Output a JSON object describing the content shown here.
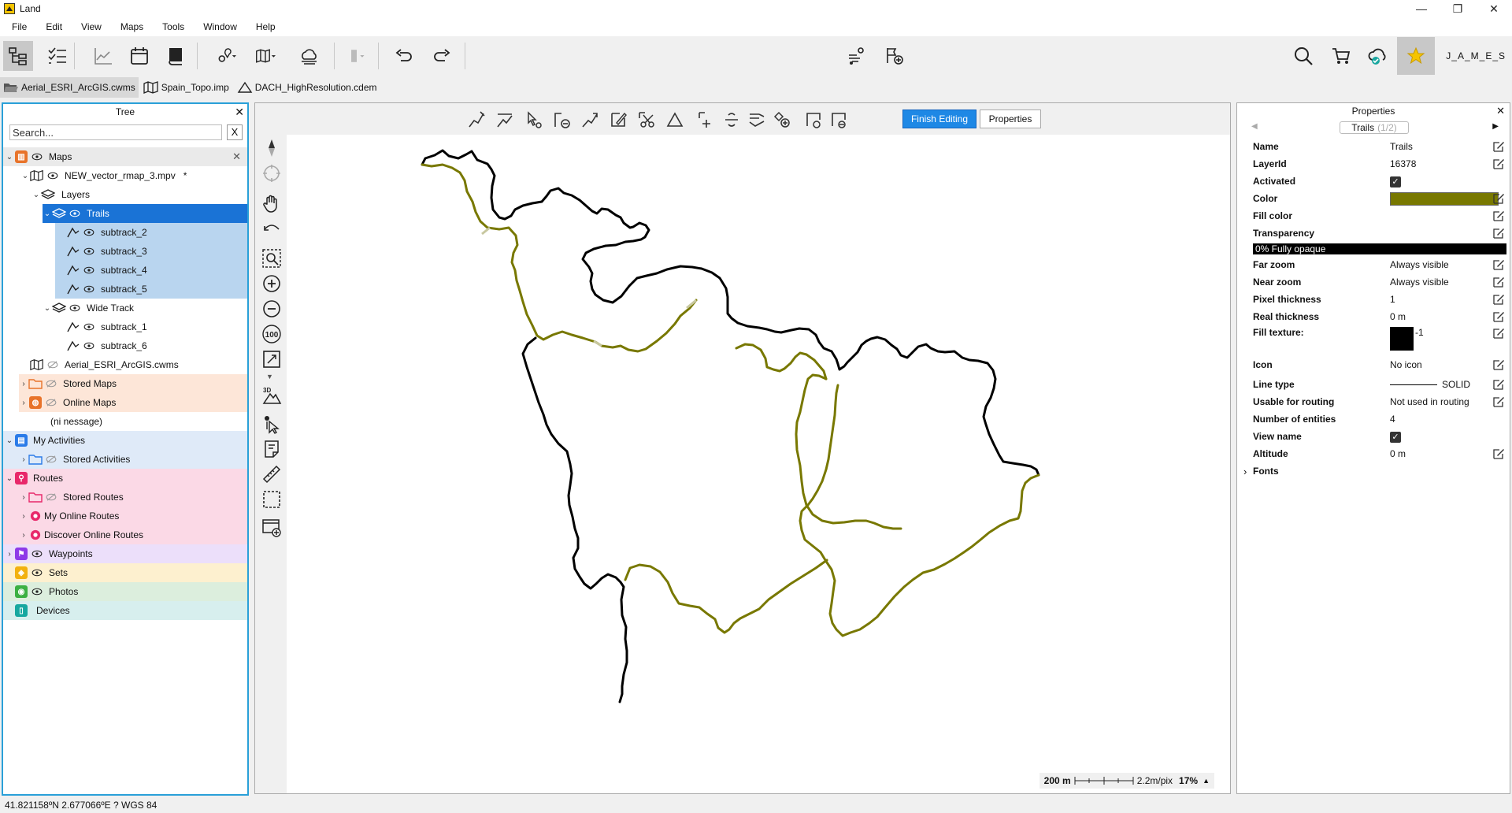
{
  "window": {
    "title": "Land",
    "minimize": "—",
    "maximize": "❐",
    "close": "✕"
  },
  "menu": [
    "File",
    "Edit",
    "View",
    "Maps",
    "Tools",
    "Window",
    "Help"
  ],
  "toolbar": {
    "user": "J_A_M_E_S"
  },
  "open_maps": [
    {
      "label": "Aerial_ESRI_ArcGIS.cwms",
      "icon": "folder-open-icon"
    },
    {
      "label": "Spain_Topo.imp",
      "icon": "map-icon"
    },
    {
      "label": "DACH_HighResolution.cdem",
      "icon": "terrain-icon"
    }
  ],
  "tree": {
    "title": "Tree",
    "close": "✕",
    "search_placeholder": "Search...",
    "search_clear": "X",
    "rows": {
      "maps": "Maps",
      "maps_close": "✕",
      "vector_map": "NEW_vector_rmap_3.mpv",
      "vector_map_mark": "*",
      "layers": "Layers",
      "trails": "Trails",
      "subtrack_2": "subtrack_2",
      "subtrack_3": "subtrack_3",
      "subtrack_4": "subtrack_4",
      "subtrack_5": "subtrack_5",
      "wide_track": "Wide Track",
      "subtrack_1": "subtrack_1",
      "subtrack_6": "subtrack_6",
      "aerial": "Aerial_ESRI_ArcGIS.cwms",
      "stored_maps": "Stored Maps",
      "online_maps": "Online Maps",
      "no_message": "(ni nessage)",
      "my_activities": "My Activities",
      "stored_activities": "Stored Activities",
      "routes": "Routes",
      "stored_routes": "Stored Routes",
      "my_online_routes": "My Online Routes",
      "discover_online_routes": "Discover Online Routes",
      "waypoints": "Waypoints",
      "sets": "Sets",
      "photos": "Photos",
      "devices": "Devices"
    },
    "colors": {
      "maps": "#e8732a",
      "activities": "#2a7be8",
      "routes": "#e8286a",
      "waypoints": "#8e3ae8",
      "sets": "#f2b10f",
      "photos": "#3cb043",
      "devices": "#16a7a0",
      "selected": "#1a73d6",
      "selected_child": "#b9d5ef"
    }
  },
  "map_toolbar": {
    "finish_editing": "Finish Editing",
    "properties": "Properties"
  },
  "scale": {
    "distance": "200 m",
    "resolution": "2.2m/pix",
    "zoom": "17%",
    "zoom_caret": "▲"
  },
  "track_colors": {
    "trail": "#787800",
    "wide": "#000000"
  },
  "properties": {
    "title": "Properties",
    "close": "✕",
    "nav_prev": "◀",
    "nav_next": "▶",
    "layer_chip": "Trails",
    "layer_page": "(1/2)",
    "name_label": "Name",
    "name_value": "Trails",
    "layerid_label": "LayerId",
    "layerid_value": "16378",
    "activated_label": "Activated",
    "activated_value": "✓",
    "color_label": "Color",
    "color_value": "#787800",
    "fillcolor_label": "Fill color",
    "fillcolor_value": "#ffffff",
    "transparency_label": "Transparency",
    "transparency_value": "0% Fully opaque",
    "farzoom_label": "Far zoom",
    "farzoom_value": "Always visible",
    "nearzoom_label": "Near zoom",
    "nearzoom_value": "Always visible",
    "pixelthick_label": "Pixel thickness",
    "pixelthick_value": "1",
    "realthick_label": "Real thickness",
    "realthick_value": "0 m",
    "filltexture_label": "Fill texture:",
    "filltexture_value": "-1",
    "icon_label": "Icon",
    "icon_value": "No icon",
    "linetype_label": "Line type",
    "linetype_value": "SOLID",
    "routing_label": "Usable for routing",
    "routing_value": "Not used in routing",
    "entities_label": "Number of entities",
    "entities_value": "4",
    "viewname_label": "View name",
    "viewname_value": "✓",
    "altitude_label": "Altitude",
    "altitude_value": "0 m",
    "fonts_label": "Fonts",
    "fonts_caret": "›"
  },
  "status": {
    "coords": "41.821158ºN 2.677066ºE  ?  WGS 84"
  }
}
